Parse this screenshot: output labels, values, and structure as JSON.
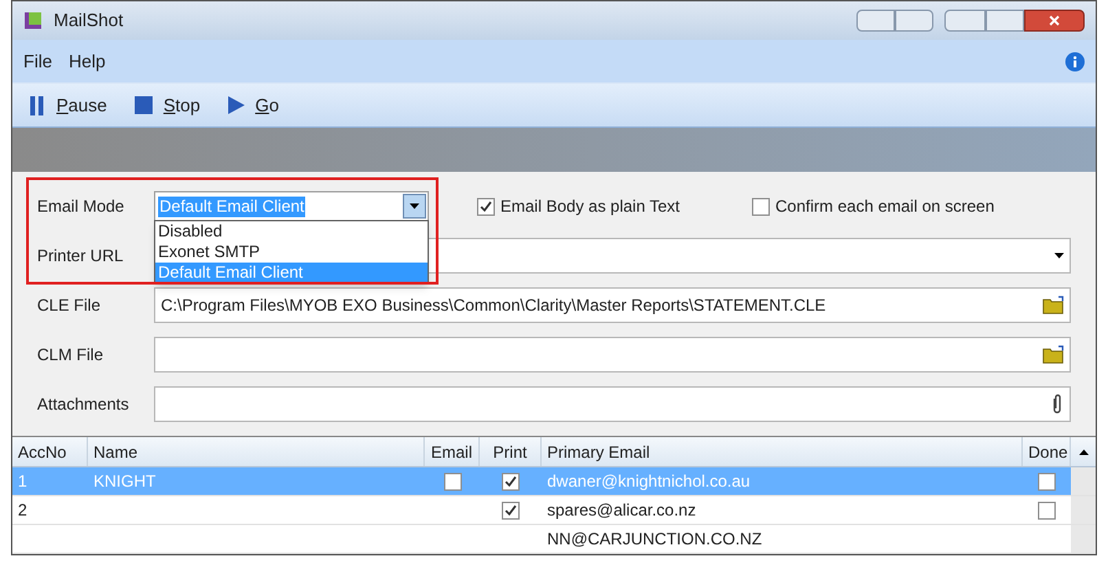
{
  "window": {
    "title": "MailShot"
  },
  "menu": [
    "File",
    "Help"
  ],
  "toolbar": [
    {
      "kind": "pause",
      "label": "Pause"
    },
    {
      "kind": "stop",
      "label": "Stop"
    },
    {
      "kind": "go",
      "label": "Go"
    }
  ],
  "email_mode": {
    "label": "Email Mode",
    "value": "Default Email Client",
    "expanded": true,
    "options": [
      {
        "label": "Disabled",
        "selected": false
      },
      {
        "label": "Exonet SMTP",
        "selected": false
      },
      {
        "label": "Default Email Client",
        "selected": true
      }
    ]
  },
  "checkboxes": [
    {
      "label": "Email Body as plain Text",
      "checked": true
    },
    {
      "label": "Confirm each email on screen",
      "checked": false
    }
  ],
  "fields": [
    {
      "kind": "dropdown",
      "label": "Printer URL"
    },
    {
      "kind": "file",
      "label": "CLE File",
      "value": "C:\\Program Files\\MYOB EXO Business\\Common\\Clarity\\Master Reports\\STATEMENT.CLE"
    },
    {
      "kind": "file",
      "label": "CLM File"
    },
    {
      "kind": "attach",
      "label": "Attachments"
    }
  ],
  "table": {
    "columns": [
      "AccNo",
      "Name",
      "Email",
      "Print",
      "Primary Email",
      "Done"
    ],
    "rows": [
      {
        "accno": "1",
        "name": "KNIGHT",
        "email": false,
        "print": true,
        "primary_email": "dwaner@knightnichol.co.au",
        "done": false,
        "selected": true
      },
      {
        "accno": "2",
        "print": true,
        "primary_email": "spares@alicar.co.nz",
        "done": false,
        "selected": false
      },
      {
        "primary_email": "NN@CARJUNCTION.CO.NZ",
        "selected": false
      }
    ]
  }
}
